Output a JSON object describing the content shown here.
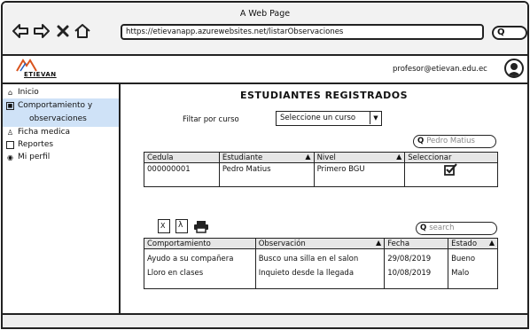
{
  "window": {
    "title": "A Web Page"
  },
  "browser": {
    "url": "https://etievanapp.azurewebsites.net/listarObservaciones"
  },
  "app": {
    "logo_text": "ETIEVAN",
    "user_email": "profesor@etievan.edu.ec"
  },
  "sidebar": {
    "items": [
      {
        "label": "Inicio",
        "icon": "home-icon"
      },
      {
        "label": "Comportamiento y",
        "icon": "calendar-icon"
      },
      {
        "label": "observaciones",
        "icon": ""
      },
      {
        "label": "Ficha medica",
        "icon": "medical-icon"
      },
      {
        "label": "Reportes",
        "icon": "report-icon"
      },
      {
        "label": "Mi perfil",
        "icon": "profile-icon"
      }
    ]
  },
  "main": {
    "heading": "ESTUDIANTES REGISTRADOS",
    "filter_label": "Filtar por curso",
    "filter_select": "Seleccione un curso",
    "student_search": "Pedro Matius",
    "students": {
      "columns": [
        "Cedula",
        "Estudiante",
        "Nivel",
        "Seleccionar"
      ],
      "rows": [
        {
          "cedula": "000000001",
          "estudiante": "Pedro Matius",
          "nivel": "Primero BGU",
          "selected": true
        }
      ]
    },
    "obs_search_placeholder": "search",
    "observations": {
      "columns": [
        "Comportamiento",
        "Observación",
        "Fecha",
        "Estado"
      ],
      "rows": [
        {
          "comportamiento": "Ayudo a su compañera",
          "observacion": "Busco una silla en el salon",
          "fecha": "29/08/2019",
          "estado": "Bueno"
        },
        {
          "comportamiento": "Lloro en clases",
          "observacion": "Inquieto desde la llegada",
          "fecha": "10/08/2019",
          "estado": "Malo"
        }
      ]
    }
  }
}
